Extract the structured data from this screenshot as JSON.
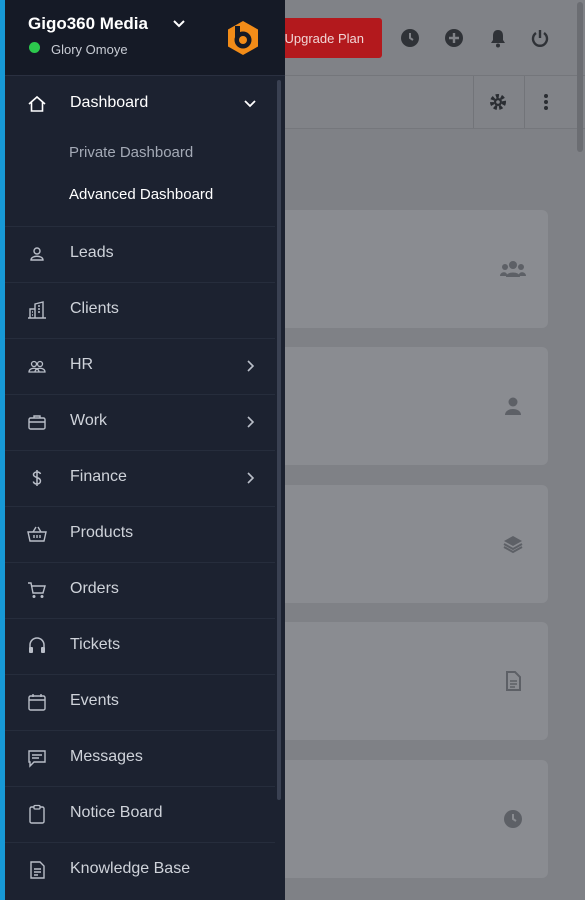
{
  "header": {
    "upgrade_label": "Upgrade Plan",
    "icons": [
      "clock-icon",
      "plus-circle-icon",
      "bell-icon",
      "power-icon"
    ],
    "toolbar_icons": [
      "gear-icon",
      "more-vertical-icon"
    ]
  },
  "cards": [
    {
      "icon": "users-icon"
    },
    {
      "icon": "user-icon"
    },
    {
      "icon": "layers-icon"
    },
    {
      "icon": "document-icon"
    },
    {
      "icon": "clock-icon"
    }
  ],
  "sidebar": {
    "brand": "Gigo360 Media",
    "user_name": "Glory Omoye",
    "status_color": "#2cc84d",
    "accent_color": "#f28c18",
    "dashboard": {
      "label": "Dashboard",
      "icon": "home-icon",
      "submenu": [
        "Private Dashboard",
        "Advanced Dashboard"
      ]
    },
    "items": [
      {
        "label": "Leads",
        "icon": "user-outline-icon",
        "chevron": false
      },
      {
        "label": "Clients",
        "icon": "building-icon",
        "chevron": false
      },
      {
        "label": "HR",
        "icon": "people-icon",
        "chevron": true
      },
      {
        "label": "Work",
        "icon": "briefcase-icon",
        "chevron": true
      },
      {
        "label": "Finance",
        "icon": "dollar-icon",
        "chevron": true
      },
      {
        "label": "Products",
        "icon": "basket-icon",
        "chevron": false
      },
      {
        "label": "Orders",
        "icon": "cart-icon",
        "chevron": false
      },
      {
        "label": "Tickets",
        "icon": "headset-icon",
        "chevron": false
      },
      {
        "label": "Events",
        "icon": "calendar-icon",
        "chevron": false
      },
      {
        "label": "Messages",
        "icon": "chat-icon",
        "chevron": false
      },
      {
        "label": "Notice Board",
        "icon": "clipboard-icon",
        "chevron": false
      },
      {
        "label": "Knowledge Base",
        "icon": "book-icon",
        "chevron": false
      }
    ]
  }
}
